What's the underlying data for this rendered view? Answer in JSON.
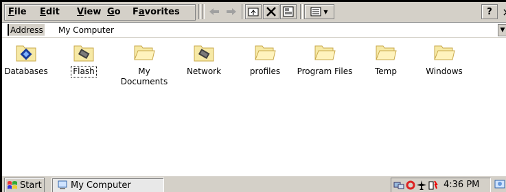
{
  "menu": {
    "items": [
      "File",
      "Edit",
      "View",
      "Go",
      "Favorites"
    ]
  },
  "toolbar": {
    "help_label": "?",
    "close_label": "×"
  },
  "address": {
    "label": "Address",
    "value": "My Computer"
  },
  "items": [
    {
      "label": "Databases",
      "icon": "database-icon"
    },
    {
      "label": "Flash",
      "icon": "flash-storage-icon"
    },
    {
      "label": "My\nDocuments",
      "icon": "folder-icon"
    },
    {
      "label": "Network",
      "icon": "network-drive-icon"
    },
    {
      "label": "profiles",
      "icon": "folder-icon"
    },
    {
      "label": "Program Files",
      "icon": "folder-icon"
    },
    {
      "label": "Temp",
      "icon": "folder-icon"
    },
    {
      "label": "Windows",
      "icon": "folder-icon"
    }
  ],
  "taskbar": {
    "start_label": "Start",
    "task_label": "My Computer",
    "clock": "4:36 PM"
  },
  "colors": {
    "chrome": "#d4d0c8",
    "folder": "#f6e9a6",
    "folder_edge": "#c8a84a"
  }
}
